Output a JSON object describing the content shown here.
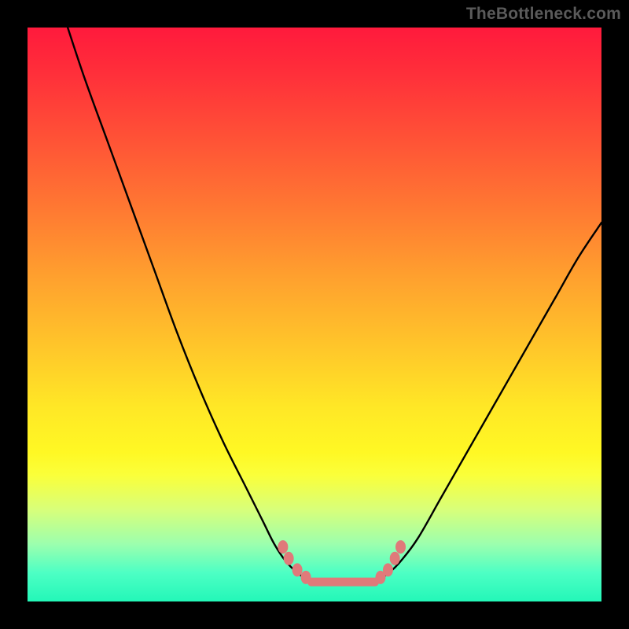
{
  "watermark": "TheBottleneck.com",
  "colors": {
    "frame": "#000000",
    "curve": "#000000",
    "marker": "#e07a7a",
    "gradient_top": "#ff1a3c",
    "gradient_bottom": "#23f7b8"
  },
  "chart_data": {
    "type": "line",
    "title": "",
    "xlabel": "",
    "ylabel": "",
    "xlim": [
      0,
      100
    ],
    "ylim": [
      0,
      100
    ],
    "grid": false,
    "legend": false,
    "series": [
      {
        "name": "left-curve",
        "x": [
          7,
          10,
          14,
          18,
          22,
          26,
          30,
          34,
          38,
          41,
          43,
          45,
          47,
          48.5
        ],
        "y": [
          100,
          91,
          80,
          69,
          58,
          47,
          37,
          28,
          20,
          14,
          10,
          7,
          5,
          4
        ]
      },
      {
        "name": "bottom-flat",
        "x": [
          48.5,
          50,
          52,
          54,
          56,
          58,
          60,
          61.5
        ],
        "y": [
          4,
          3.5,
          3.3,
          3.3,
          3.3,
          3.4,
          3.6,
          4
        ]
      },
      {
        "name": "right-curve",
        "x": [
          61.5,
          63,
          65,
          68,
          72,
          76,
          80,
          84,
          88,
          92,
          96,
          100
        ],
        "y": [
          4,
          5,
          7,
          11,
          18,
          25,
          32,
          39,
          46,
          53,
          60,
          66
        ]
      }
    ],
    "markers": {
      "name": "highlighted-points",
      "points": [
        {
          "x": 44.5,
          "y": 9.5
        },
        {
          "x": 45.5,
          "y": 7.5
        },
        {
          "x": 47.0,
          "y": 5.5
        },
        {
          "x": 48.5,
          "y": 4.2
        },
        {
          "x": 61.5,
          "y": 4.2
        },
        {
          "x": 62.8,
          "y": 5.5
        },
        {
          "x": 64.0,
          "y": 7.5
        },
        {
          "x": 65.0,
          "y": 9.5
        }
      ],
      "flat_band": {
        "x0": 49.5,
        "x1": 60.5,
        "y": 3.4
      }
    },
    "background_gradient": {
      "axis": "y",
      "stops": [
        {
          "y": 100,
          "color": "#ff1a3c"
        },
        {
          "y": 80,
          "color": "#ff5436"
        },
        {
          "y": 60,
          "color": "#ffa22e"
        },
        {
          "y": 40,
          "color": "#ffe726"
        },
        {
          "y": 20,
          "color": "#f4ff50"
        },
        {
          "y": 5,
          "color": "#7affb0"
        },
        {
          "y": 0,
          "color": "#23f7b8"
        }
      ]
    }
  }
}
